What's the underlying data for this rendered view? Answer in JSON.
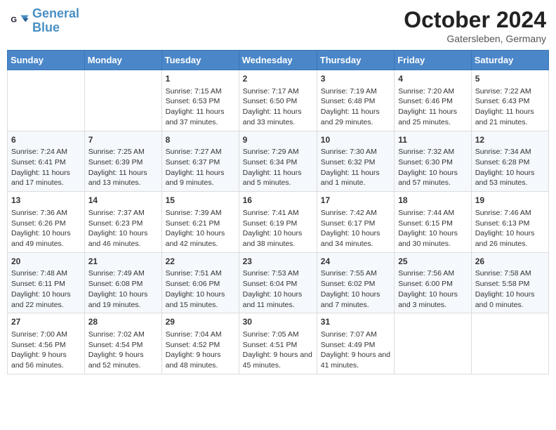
{
  "header": {
    "logo_line1": "General",
    "logo_line2": "Blue",
    "month": "October 2024",
    "location": "Gatersleben, Germany"
  },
  "days_of_week": [
    "Sunday",
    "Monday",
    "Tuesday",
    "Wednesday",
    "Thursday",
    "Friday",
    "Saturday"
  ],
  "weeks": [
    [
      {
        "day": "",
        "info": ""
      },
      {
        "day": "",
        "info": ""
      },
      {
        "day": "1",
        "info": "Sunrise: 7:15 AM\nSunset: 6:53 PM\nDaylight: 11 hours and 37 minutes."
      },
      {
        "day": "2",
        "info": "Sunrise: 7:17 AM\nSunset: 6:50 PM\nDaylight: 11 hours and 33 minutes."
      },
      {
        "day": "3",
        "info": "Sunrise: 7:19 AM\nSunset: 6:48 PM\nDaylight: 11 hours and 29 minutes."
      },
      {
        "day": "4",
        "info": "Sunrise: 7:20 AM\nSunset: 6:46 PM\nDaylight: 11 hours and 25 minutes."
      },
      {
        "day": "5",
        "info": "Sunrise: 7:22 AM\nSunset: 6:43 PM\nDaylight: 11 hours and 21 minutes."
      }
    ],
    [
      {
        "day": "6",
        "info": "Sunrise: 7:24 AM\nSunset: 6:41 PM\nDaylight: 11 hours and 17 minutes."
      },
      {
        "day": "7",
        "info": "Sunrise: 7:25 AM\nSunset: 6:39 PM\nDaylight: 11 hours and 13 minutes."
      },
      {
        "day": "8",
        "info": "Sunrise: 7:27 AM\nSunset: 6:37 PM\nDaylight: 11 hours and 9 minutes."
      },
      {
        "day": "9",
        "info": "Sunrise: 7:29 AM\nSunset: 6:34 PM\nDaylight: 11 hours and 5 minutes."
      },
      {
        "day": "10",
        "info": "Sunrise: 7:30 AM\nSunset: 6:32 PM\nDaylight: 11 hours and 1 minute."
      },
      {
        "day": "11",
        "info": "Sunrise: 7:32 AM\nSunset: 6:30 PM\nDaylight: 10 hours and 57 minutes."
      },
      {
        "day": "12",
        "info": "Sunrise: 7:34 AM\nSunset: 6:28 PM\nDaylight: 10 hours and 53 minutes."
      }
    ],
    [
      {
        "day": "13",
        "info": "Sunrise: 7:36 AM\nSunset: 6:26 PM\nDaylight: 10 hours and 49 minutes."
      },
      {
        "day": "14",
        "info": "Sunrise: 7:37 AM\nSunset: 6:23 PM\nDaylight: 10 hours and 46 minutes."
      },
      {
        "day": "15",
        "info": "Sunrise: 7:39 AM\nSunset: 6:21 PM\nDaylight: 10 hours and 42 minutes."
      },
      {
        "day": "16",
        "info": "Sunrise: 7:41 AM\nSunset: 6:19 PM\nDaylight: 10 hours and 38 minutes."
      },
      {
        "day": "17",
        "info": "Sunrise: 7:42 AM\nSunset: 6:17 PM\nDaylight: 10 hours and 34 minutes."
      },
      {
        "day": "18",
        "info": "Sunrise: 7:44 AM\nSunset: 6:15 PM\nDaylight: 10 hours and 30 minutes."
      },
      {
        "day": "19",
        "info": "Sunrise: 7:46 AM\nSunset: 6:13 PM\nDaylight: 10 hours and 26 minutes."
      }
    ],
    [
      {
        "day": "20",
        "info": "Sunrise: 7:48 AM\nSunset: 6:11 PM\nDaylight: 10 hours and 22 minutes."
      },
      {
        "day": "21",
        "info": "Sunrise: 7:49 AM\nSunset: 6:08 PM\nDaylight: 10 hours and 19 minutes."
      },
      {
        "day": "22",
        "info": "Sunrise: 7:51 AM\nSunset: 6:06 PM\nDaylight: 10 hours and 15 minutes."
      },
      {
        "day": "23",
        "info": "Sunrise: 7:53 AM\nSunset: 6:04 PM\nDaylight: 10 hours and 11 minutes."
      },
      {
        "day": "24",
        "info": "Sunrise: 7:55 AM\nSunset: 6:02 PM\nDaylight: 10 hours and 7 minutes."
      },
      {
        "day": "25",
        "info": "Sunrise: 7:56 AM\nSunset: 6:00 PM\nDaylight: 10 hours and 3 minutes."
      },
      {
        "day": "26",
        "info": "Sunrise: 7:58 AM\nSunset: 5:58 PM\nDaylight: 10 hours and 0 minutes."
      }
    ],
    [
      {
        "day": "27",
        "info": "Sunrise: 7:00 AM\nSunset: 4:56 PM\nDaylight: 9 hours and 56 minutes."
      },
      {
        "day": "28",
        "info": "Sunrise: 7:02 AM\nSunset: 4:54 PM\nDaylight: 9 hours and 52 minutes."
      },
      {
        "day": "29",
        "info": "Sunrise: 7:04 AM\nSunset: 4:52 PM\nDaylight: 9 hours and 48 minutes."
      },
      {
        "day": "30",
        "info": "Sunrise: 7:05 AM\nSunset: 4:51 PM\nDaylight: 9 hours and 45 minutes."
      },
      {
        "day": "31",
        "info": "Sunrise: 7:07 AM\nSunset: 4:49 PM\nDaylight: 9 hours and 41 minutes."
      },
      {
        "day": "",
        "info": ""
      },
      {
        "day": "",
        "info": ""
      }
    ]
  ]
}
